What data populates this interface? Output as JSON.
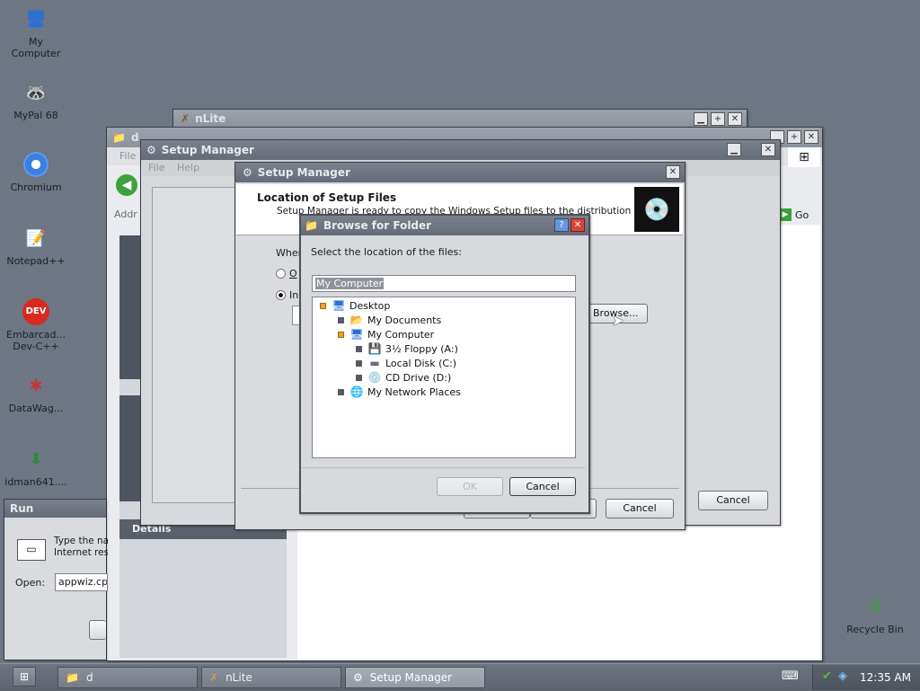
{
  "desktop": {
    "icons": [
      {
        "label": "My\nComputer",
        "name": "my-computer"
      },
      {
        "label": "MyPal 68",
        "name": "mypal"
      },
      {
        "label": "Chromium",
        "name": "chromium"
      },
      {
        "label": "Notepad++",
        "name": "notepadpp"
      },
      {
        "label": "Embarcad...\nDev-C++",
        "name": "devcpp"
      },
      {
        "label": "DataWag...",
        "name": "datawag"
      },
      {
        "label": "idman641....",
        "name": "idman"
      },
      {
        "label": "Recycle Bin",
        "name": "recycle-bin"
      }
    ]
  },
  "nlite_window": {
    "title": "nLite"
  },
  "explorer_window": {
    "title": "d",
    "menu": [
      "File"
    ],
    "address_label": "Addr",
    "go_label": "Go",
    "side_details": "Details"
  },
  "setup_manager_back": {
    "title": "Setup Manager",
    "menu": [
      "File",
      "Help"
    ],
    "cancel_label": "Cancel"
  },
  "setup_manager_front": {
    "title": "Setup Manager",
    "header_title": "Location of Setup Files",
    "header_desc": "Setup Manager is ready to copy the Windows Setup files to the distribution share.",
    "where_label": "Where",
    "option_a": "O",
    "option_b": "In",
    "browse_label": "Browse...",
    "cancel_label": "Cancel"
  },
  "browse_dialog": {
    "title": "Browse for Folder",
    "prompt": "Select the location of the files:",
    "selected_value": "My Computer",
    "tree": [
      {
        "label": "Desktop",
        "icon": "desktop-icon"
      },
      {
        "label": "My Documents",
        "icon": "folder-icon"
      },
      {
        "label": "My Computer",
        "icon": "computer-icon"
      },
      {
        "label": "3½ Floppy (A:)",
        "icon": "floppy-icon"
      },
      {
        "label": "Local Disk (C:)",
        "icon": "disk-icon"
      },
      {
        "label": "CD Drive (D:)",
        "icon": "cd-drive-icon"
      },
      {
        "label": "My Network Places",
        "icon": "network-icon"
      }
    ],
    "ok_label": "OK",
    "cancel_label": "Cancel"
  },
  "run_dialog": {
    "title": "Run",
    "desc": "Type the na\nInternet res",
    "open_label": "Open:",
    "open_value": "appwiz.cpl"
  },
  "taskbar": {
    "items": [
      "d",
      "nLite",
      "Setup Manager"
    ],
    "clock": "12:35 AM"
  }
}
